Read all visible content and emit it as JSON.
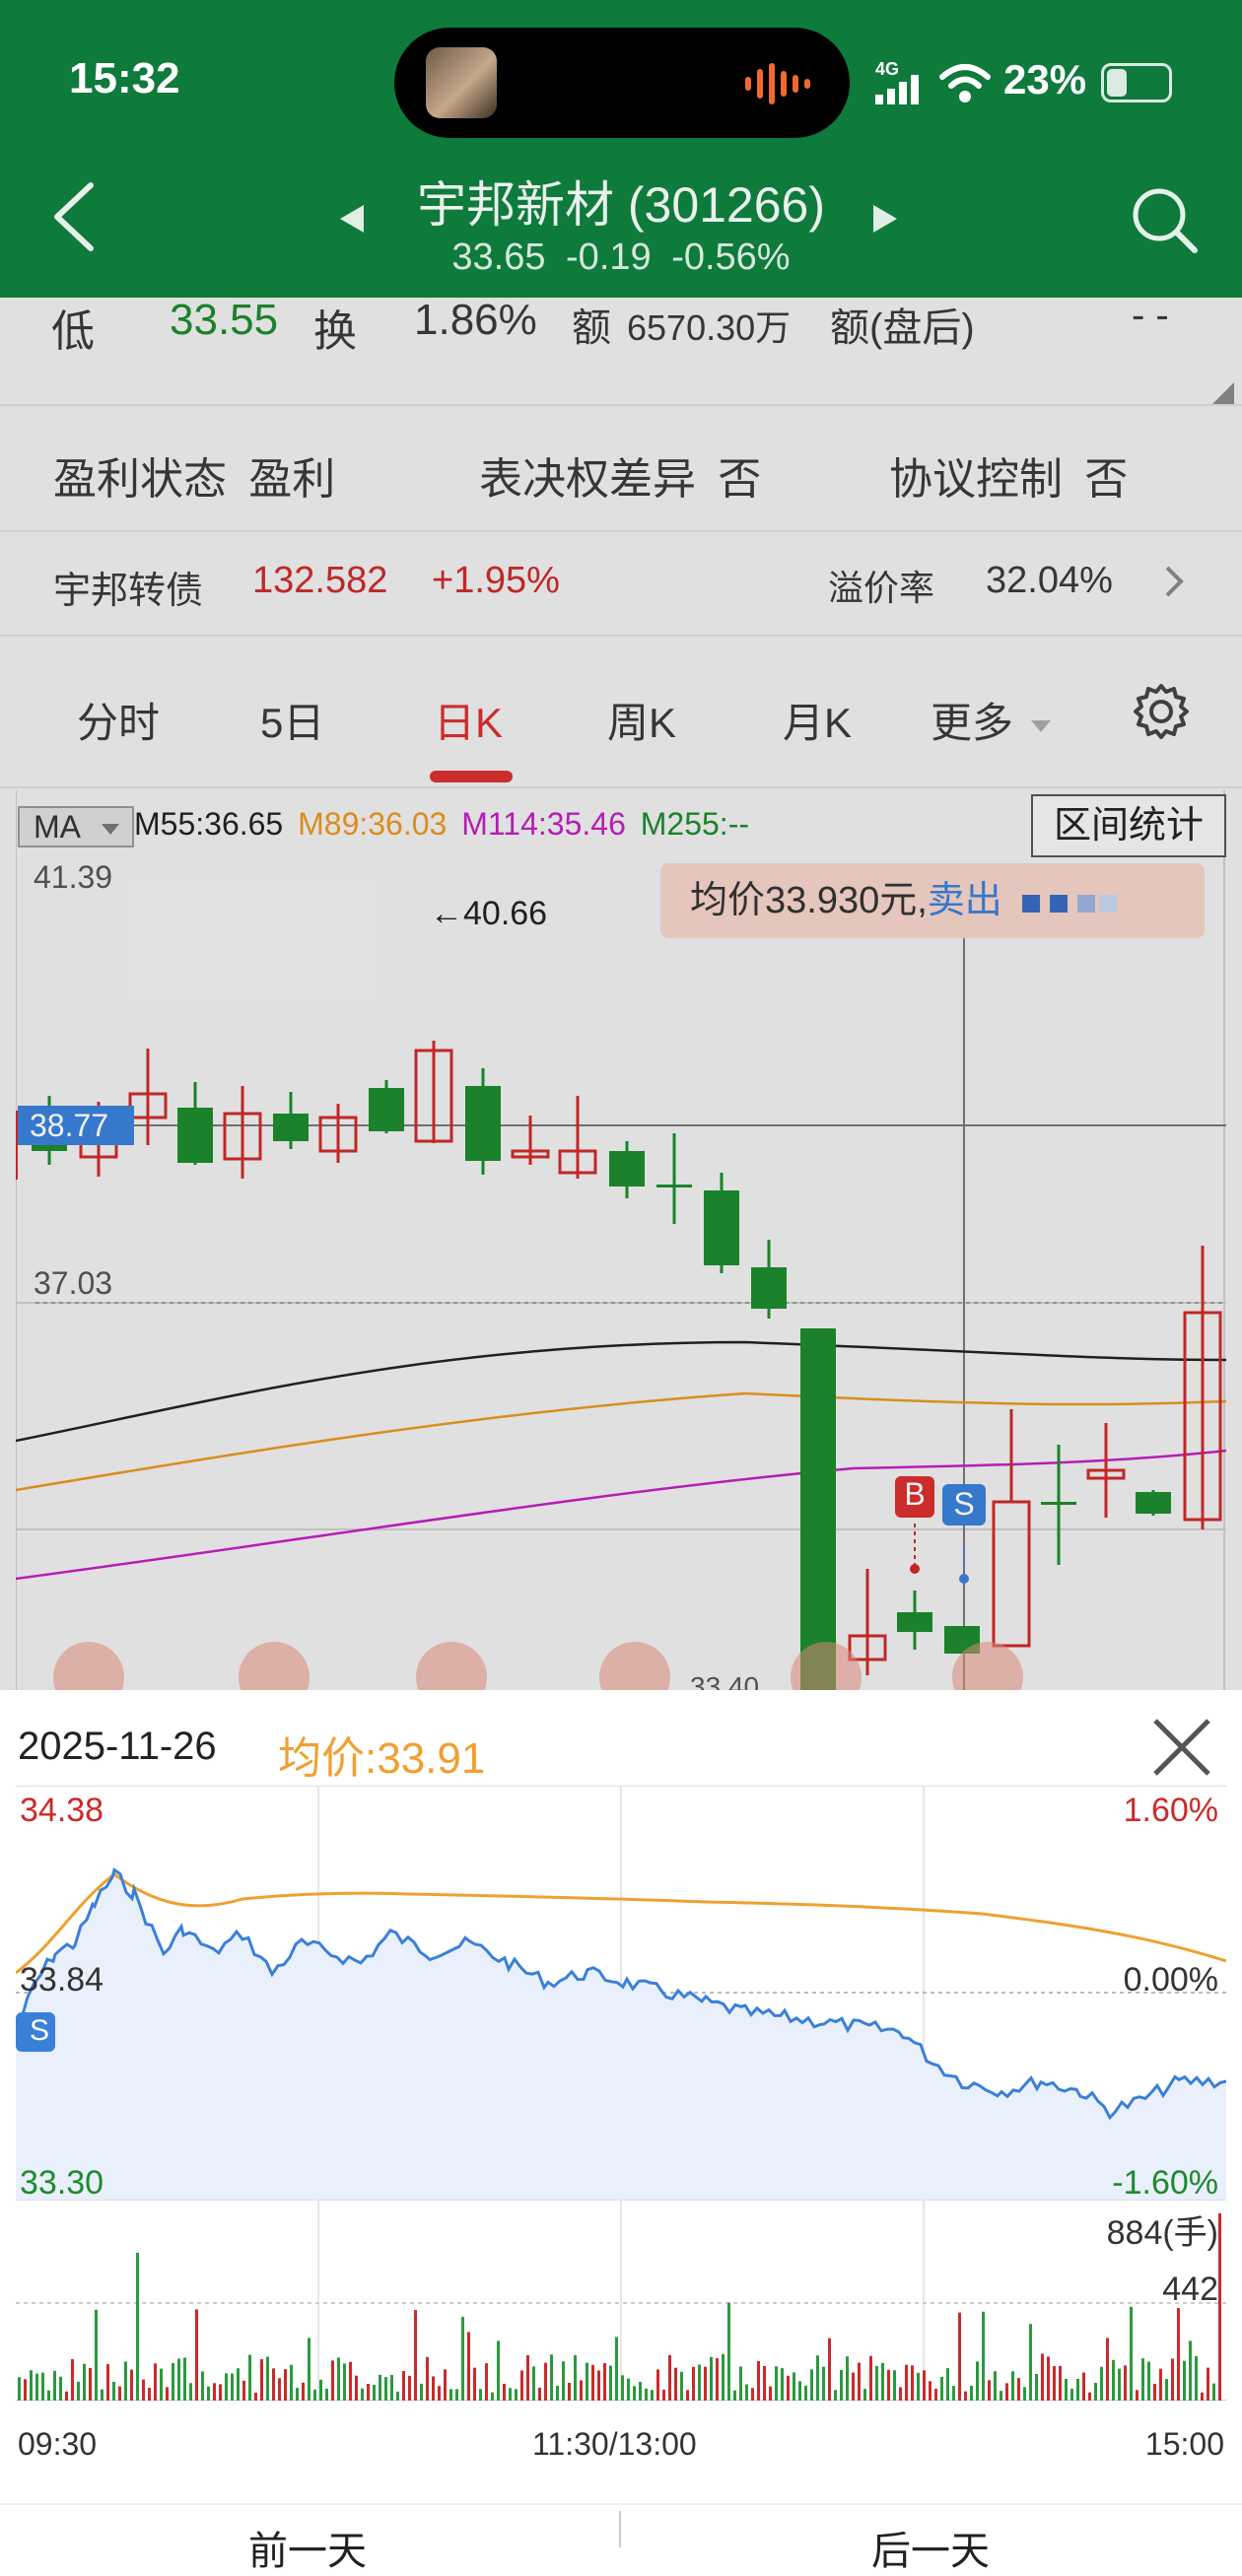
{
  "status": {
    "time": "15:32",
    "network": "4G",
    "battery": "23%",
    "battery_fraction": 0.23
  },
  "header": {
    "title": "宇邦新材 (301266)",
    "subtitle": "33.65  -0.19  -0.56%"
  },
  "quote_row": {
    "low_label": "低",
    "low_value": "33.55",
    "turnover_label": "换",
    "turnover_value": "1.86%",
    "amount_label": "额",
    "amount_value": "6570.30万",
    "after_label": "额(盘后)",
    "after_value": "- -"
  },
  "attributes": [
    {
      "label": "盈利状态",
      "value": "盈利"
    },
    {
      "label": "表决权差异",
      "value": "否"
    },
    {
      "label": "协议控制",
      "value": "否"
    }
  ],
  "bond": {
    "name": "宇邦转债",
    "price": "132.582",
    "change": "+1.95%",
    "premium_label": "溢价率",
    "premium_value": "32.04%"
  },
  "tabs": [
    "分时",
    "5日",
    "日K",
    "周K",
    "月K",
    "更多"
  ],
  "active_tab": "日K",
  "kline": {
    "ma_button": "MA",
    "ma_legend": [
      {
        "label": "M55:36.65",
        "color": "#222222"
      },
      {
        "label": "M89:36.03",
        "color": "#e8961e"
      },
      {
        "label": "M114:35.46",
        "color": "#c020c0"
      },
      {
        "label": "M255:--",
        "color": "#1d8a2e"
      }
    ],
    "range_button": "区间统计",
    "tooltip_prefix": "均价33.930元,",
    "tooltip_action": "卖出",
    "y_top": "41.39",
    "y_mid": "37.03",
    "crosshair_price": "38.77",
    "high_marker": "←40.66",
    "low_marker": "33.40",
    "buy_marker": "B",
    "sell_marker": "S"
  },
  "intraday": {
    "date": "2025-11-26",
    "avg_label": "均价:33.91",
    "price_high": "34.38",
    "price_mid": "33.84",
    "price_low": "33.30",
    "pct_high": "1.60%",
    "pct_mid": "0.00%",
    "pct_low": "-1.60%",
    "vol_max": "884(手)",
    "vol_mid": "442",
    "time_start": "09:30",
    "time_mid": "11:30/13:00",
    "time_end": "15:00",
    "sell_marker": "S"
  },
  "bottom_tabs": {
    "prev": "前一天",
    "next": "后一天"
  },
  "colors": {
    "header_green": "#0e7a3c",
    "up": "#cc2a2a",
    "down": "#1d8a2e",
    "price_line": "#3a80d8",
    "avg_line": "#f0a030"
  }
}
